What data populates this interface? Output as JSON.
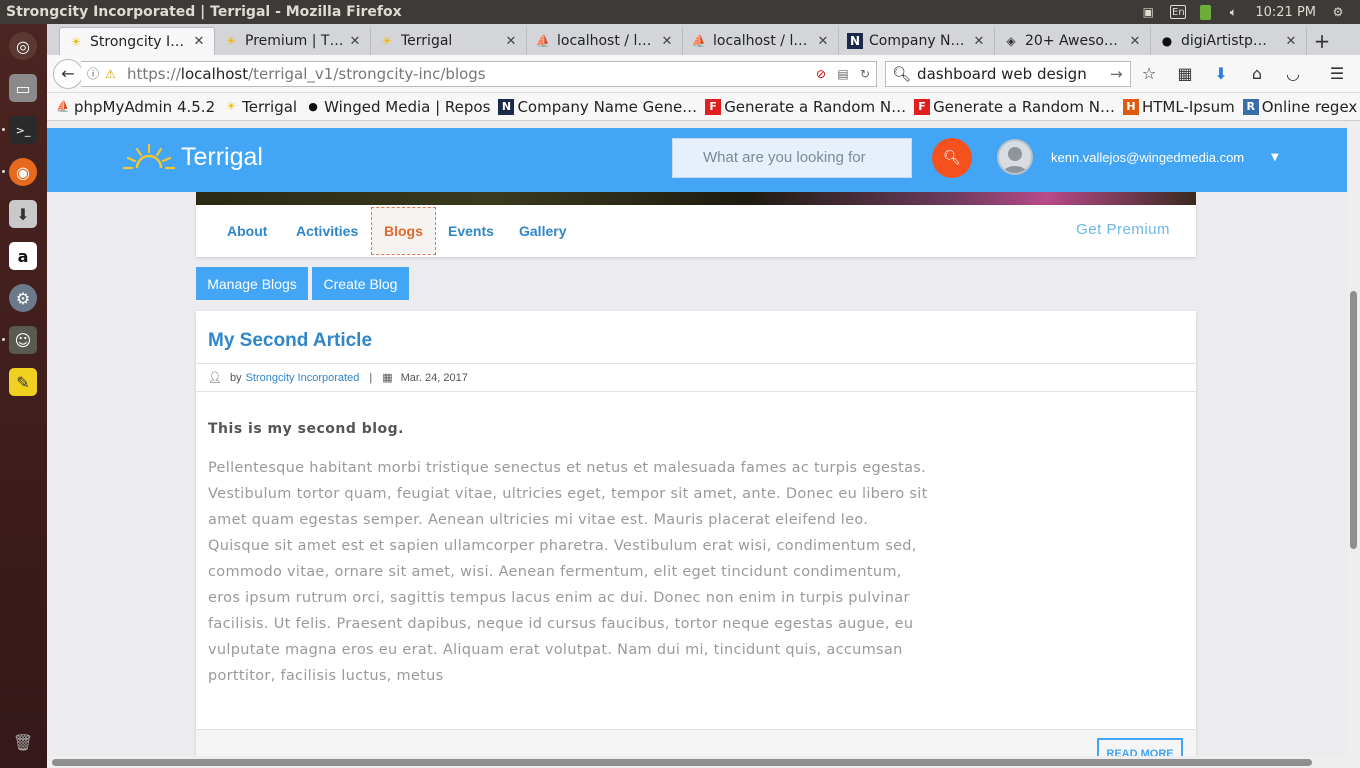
{
  "os": {
    "window_title": "Strongcity Incorporated | Terrigal - Mozilla Firefox",
    "keyboard": "En",
    "clock": "10:21 PM"
  },
  "browser": {
    "tabs": [
      {
        "label": "Strongcity I…",
        "active": true
      },
      {
        "label": "Premium | T…",
        "active": false
      },
      {
        "label": "Terrigal",
        "active": false
      },
      {
        "label": "localhost / l…",
        "active": false
      },
      {
        "label": "localhost / l…",
        "active": false
      },
      {
        "label": "Company N…",
        "active": false
      },
      {
        "label": "20+ Aweso…",
        "active": false
      },
      {
        "label": "digiArtistp…",
        "active": false
      }
    ],
    "url_prefix": "https://",
    "url_host": "localhost",
    "url_path": "/terrigal_v1/strongcity-inc/blogs",
    "search_query": "dashboard web design",
    "bookmarks": [
      "phpMyAdmin 4.5.2",
      "Terrigal",
      "Winged Media | Repos",
      "Company Name Gene…",
      "Generate a Random N…",
      "Generate a Random N…",
      "HTML-Ipsum",
      "Online regex tester"
    ]
  },
  "site": {
    "logo_text": "Terrigal",
    "search_placeholder": "What are you looking for",
    "user_email": "kenn.vallejos@wingedmedia.com",
    "nav": [
      "About",
      "Activities",
      "Blogs",
      "Events",
      "Gallery"
    ],
    "active_nav": "Blogs",
    "get_premium": "Get Premium",
    "manage_blogs": "Manage Blogs",
    "create_blog": "Create Blog",
    "accent_color": "#42a5f5",
    "search_button_color": "#f4511e"
  },
  "article": {
    "title": "My Second Article",
    "by": "by",
    "author": "Strongcity Incorporated",
    "date": "Mar. 24, 2017",
    "lead": "This is my second blog.",
    "body": "Pellentesque habitant morbi tristique senectus et netus et malesuada fames ac turpis egestas. Vestibulum tortor quam, feugiat vitae, ultricies eget, tempor sit amet, ante. Donec eu libero sit amet quam egestas semper. Aenean ultricies mi vitae est. Mauris placerat eleifend leo. Quisque sit amet est et sapien ullamcorper pharetra. Vestibulum erat wisi, condimentum sed, commodo vitae, ornare sit amet, wisi. Aenean fermentum, elit eget tincidunt condimentum, eros ipsum rutrum orci, sagittis tempus lacus enim ac dui. Donec non enim in turpis pulvinar facilisis. Ut felis. Praesent dapibus, neque id cursus faucibus, tortor neque egestas augue, eu vulputate magna eros eu erat. Aliquam erat volutpat. Nam dui mi, tincidunt quis, accumsan porttitor, facilisis luctus, metus",
    "read_more": "READ MORE"
  }
}
